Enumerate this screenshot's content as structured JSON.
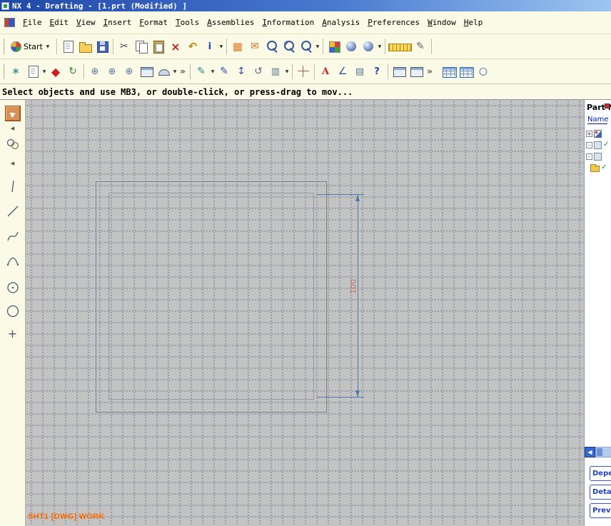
{
  "window": {
    "title": "NX 4 - Drafting - [1.prt (Modified) ]"
  },
  "menubar": {
    "items": [
      "File",
      "Edit",
      "View",
      "Insert",
      "Format",
      "Tools",
      "Assemblies",
      "Information",
      "Analysis",
      "Preferences",
      "Window",
      "Help"
    ]
  },
  "toolbar": {
    "start_label": "Start"
  },
  "prompt": {
    "text": "Select objects and use MB3, or double-click, or press-drag to mov..."
  },
  "drawing": {
    "dimension_value": "100",
    "sheet_label": "SHT1 [DWG] WORK"
  },
  "part_navigator": {
    "title": "Part N",
    "column": "Name",
    "expanders": [
      "+",
      "-",
      "-"
    ],
    "check": "✓",
    "panel_buttons": [
      "Depe",
      "Deta",
      "Prev"
    ],
    "scroll_left": "◀"
  },
  "glyphs": {
    "dropdown": "▼",
    "overflow": "»",
    "collapse_left": "◀",
    "scissors": "✂",
    "close": "×",
    "undo": "↶",
    "info": "i",
    "grid_orange": "▦",
    "envelope": "✉",
    "asterisk": "∗",
    "diamond": "◆",
    "rotate_cw": "↻",
    "rotate_ccw": "↺",
    "datum": "⊕",
    "pencil": "✎",
    "updown": "↕",
    "angle": "∠",
    "letter_a": "A",
    "help": "?",
    "plus": "+",
    "circle": "○",
    "grid_blue": "▥",
    "grid_lines": "▤"
  }
}
